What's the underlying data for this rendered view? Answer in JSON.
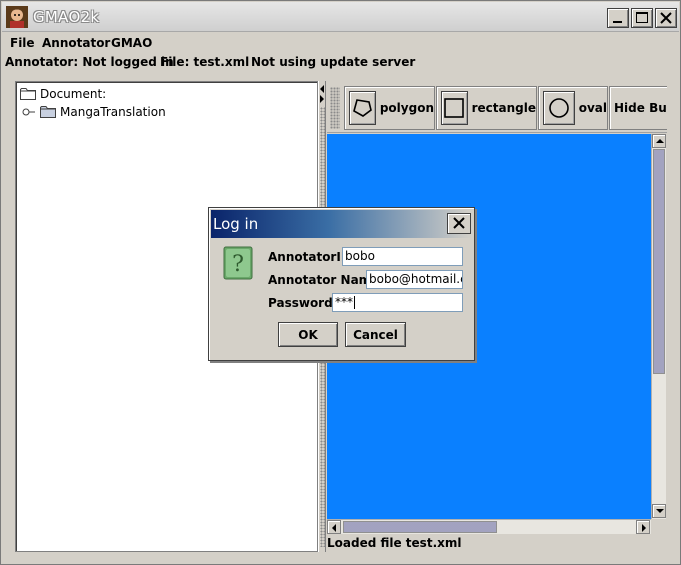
{
  "window": {
    "title": "GMAO2k"
  },
  "menu": {
    "items": [
      "File",
      "Annotator",
      "GMAO"
    ]
  },
  "status": {
    "annotator": "Annotator: Not logged in",
    "file": "File: test.xml",
    "server": "Not using update server"
  },
  "tree": {
    "root": "Document:",
    "child": "MangaTranslation"
  },
  "toolbar": {
    "polygon": "polygon",
    "rectangle": "rectangle",
    "oval": "oval",
    "hide_bubbles": "Hide Bubbl"
  },
  "canvas": {
    "color": "#0a80ff"
  },
  "footer": {
    "loaded": "Loaded file test.xml"
  },
  "dialog": {
    "title": "Log in",
    "annotator_id_label": "AnnotatorID:",
    "annotator_id_value": "bobo",
    "annotator_name_label": "Annotator Name:",
    "annotator_name_value": "bobo@hotmail.co",
    "password_label": "Password:",
    "password_value": "***",
    "ok": "OK",
    "cancel": "Cancel"
  }
}
